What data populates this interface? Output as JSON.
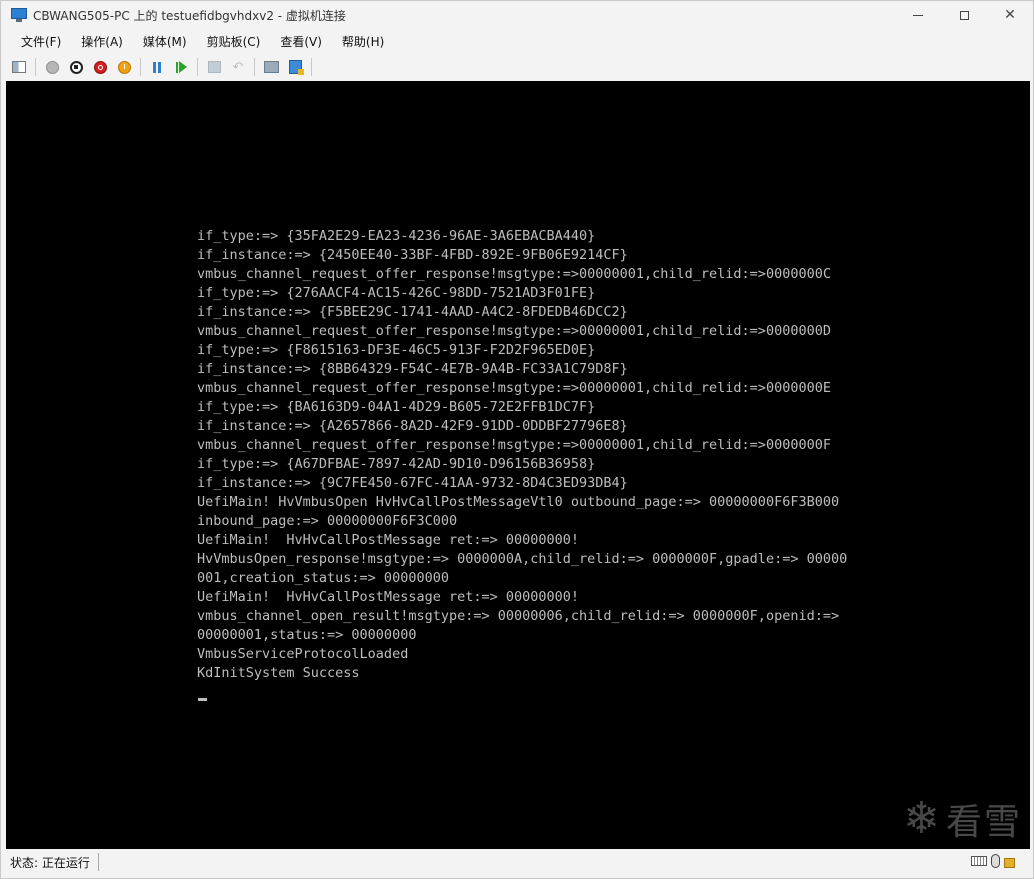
{
  "window": {
    "title": "CBWANG505-PC 上的 testuefidbgvhdxv2 - 虚拟机连接",
    "minimize_glyph": "",
    "close_glyph": "✕"
  },
  "menu": {
    "items": [
      "文件(F)",
      "操作(A)",
      "媒体(M)",
      "剪贴板(C)",
      "查看(V)",
      "帮助(H)"
    ]
  },
  "toolbar": {
    "icons": [
      "ctrl-alt-del-icon",
      "start-icon",
      "turn-off-icon",
      "shutdown-icon",
      "save-icon",
      "pause-icon",
      "resume-icon",
      "checkpoint-icon",
      "revert-icon",
      "enhanced-session-icon",
      "share-icon"
    ]
  },
  "console": {
    "lines": [
      "if_type:=> {35FA2E29-EA23-4236-96AE-3A6EBACBA440}",
      "if_instance:=> {2450EE40-33BF-4FBD-892E-9FB06E9214CF}",
      "vmbus_channel_request_offer_response!msgtype:=>00000001,child_relid:=>0000000C",
      "if_type:=> {276AACF4-AC15-426C-98DD-7521AD3F01FE}",
      "if_instance:=> {F5BEE29C-1741-4AAD-A4C2-8FDEDB46DCC2}",
      "vmbus_channel_request_offer_response!msgtype:=>00000001,child_relid:=>0000000D",
      "if_type:=> {F8615163-DF3E-46C5-913F-F2D2F965ED0E}",
      "if_instance:=> {8BB64329-F54C-4E7B-9A4B-FC33A1C79D8F}",
      "vmbus_channel_request_offer_response!msgtype:=>00000001,child_relid:=>0000000E",
      "if_type:=> {BA6163D9-04A1-4D29-B605-72E2FFB1DC7F}",
      "if_instance:=> {A2657866-8A2D-42F9-91DD-0DDBF27796E8}",
      "vmbus_channel_request_offer_response!msgtype:=>00000001,child_relid:=>0000000F",
      "if_type:=> {A67DFBAE-7897-42AD-9D10-D96156B36958}",
      "if_instance:=> {9C7FE450-67FC-41AA-9732-8D4C3ED93DB4}",
      "UefiMain! HvVmbusOpen HvHvCallPostMessageVtl0 outbound_page:=> 00000000F6F3B000",
      "inbound_page:=> 00000000F6F3C000",
      "UefiMain!  HvHvCallPostMessage ret:=> 00000000!",
      "HvVmbusOpen_response!msgtype:=> 0000000A,child_relid:=> 0000000F,gpadle:=> 00000",
      "001,creation_status:=> 00000000",
      "UefiMain!  HvHvCallPostMessage ret:=> 00000000!",
      "vmbus_channel_open_result!msgtype:=> 00000006,child_relid:=> 0000000F,openid:=>",
      "00000001,status:=> 00000000",
      "VmbusServiceProtocolLoaded",
      "KdInitSystem Success"
    ]
  },
  "watermark": {
    "text": "看雪",
    "icon": "snowflake-icon"
  },
  "status": {
    "text": "状态: 正在运行"
  },
  "colors": {
    "console_bg": "#000000",
    "console_fg": "#bdbdbd",
    "chrome_bg": "#f3f3f3"
  }
}
